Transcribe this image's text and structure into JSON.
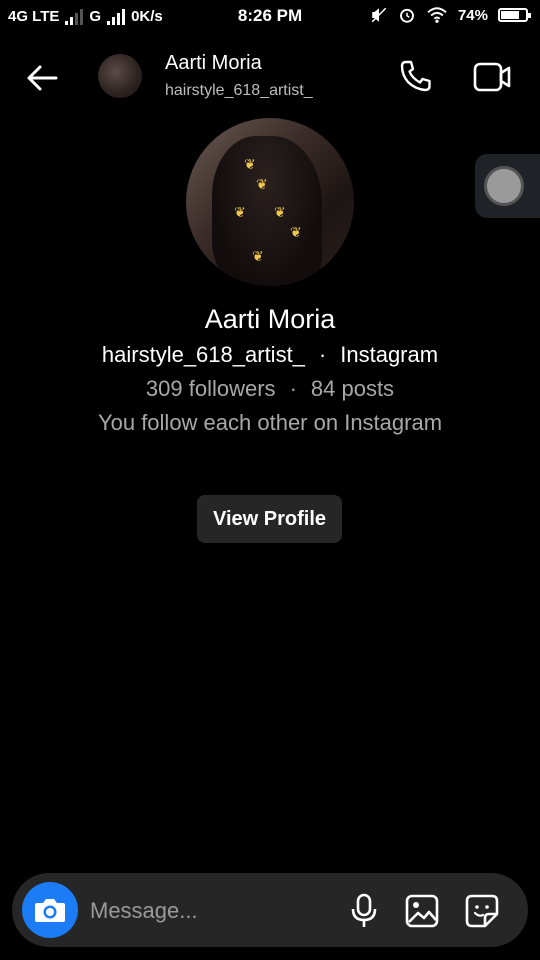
{
  "status_bar": {
    "network1": "4G LTE",
    "network2": "G",
    "speed": "0K/s",
    "time": "8:26 PM",
    "battery": "74%",
    "battery_level": 0.74
  },
  "header": {
    "name": "Aarti Moria",
    "username": "hairstyle_618_artist_"
  },
  "profile": {
    "name": "Aarti Moria",
    "username": "hairstyle_618_artist_",
    "platform": "Instagram",
    "followers": "309 followers",
    "posts": "84 posts",
    "mutual": "You follow each other on Instagram",
    "separator": "·",
    "view_profile_label": "View Profile"
  },
  "composer": {
    "placeholder": "Message..."
  },
  "colors": {
    "background": "#000000",
    "camera_accent": "#1b7cf5",
    "composer_bg": "#262626"
  },
  "icons": [
    "back-arrow-icon",
    "phone-icon",
    "video-icon",
    "camera-icon",
    "microphone-icon",
    "gallery-icon",
    "sticker-icon"
  ]
}
